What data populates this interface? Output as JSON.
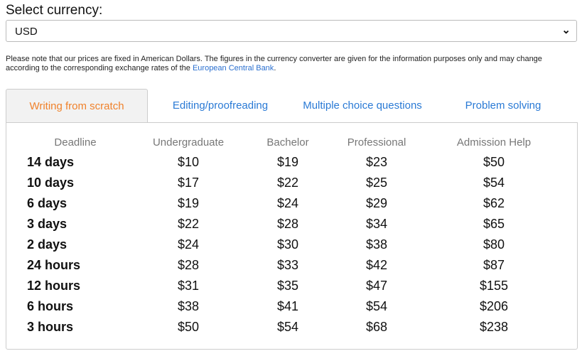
{
  "currency": {
    "label": "Select currency:",
    "value": "USD"
  },
  "note": {
    "text": "Please note that our prices are fixed in American Dollars. The figures in the currency converter are given for the information purposes only and may change according to the corresponding exchange rates of the ",
    "link": "European Central Bank",
    "end": "."
  },
  "tabs": [
    "Writing from scratch",
    "Editing/proofreading",
    "Multiple choice questions",
    "Problem solving"
  ],
  "table": {
    "headers": [
      "Deadline",
      "Undergraduate",
      "Bachelor",
      "Professional",
      "Admission Help"
    ],
    "rows": [
      [
        "14 days",
        "$10",
        "$19",
        "$23",
        "$50"
      ],
      [
        "10 days",
        "$17",
        "$22",
        "$25",
        "$54"
      ],
      [
        "6 days",
        "$19",
        "$24",
        "$29",
        "$62"
      ],
      [
        "3 days",
        "$22",
        "$28",
        "$34",
        "$65"
      ],
      [
        "2 days",
        "$24",
        "$30",
        "$38",
        "$80"
      ],
      [
        "24 hours",
        "$28",
        "$33",
        "$42",
        "$87"
      ],
      [
        "12 hours",
        "$31",
        "$35",
        "$47",
        "$155"
      ],
      [
        "6 hours",
        "$38",
        "$41",
        "$54",
        "$206"
      ],
      [
        "3 hours",
        "$50",
        "$54",
        "$68",
        "$238"
      ]
    ]
  }
}
